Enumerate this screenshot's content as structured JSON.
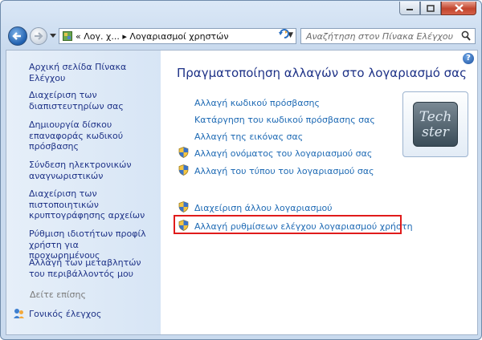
{
  "window": {
    "minimize_icon": "minimize-icon",
    "maximize_icon": "maximize-icon",
    "close_icon": "close-icon"
  },
  "navigation": {
    "breadcrumb_prefix": "«",
    "breadcrumb_parent": "Λογ. χ...",
    "breadcrumb_separator": "▸",
    "breadcrumb_current": "Λογαριασμοί χρηστών",
    "search_placeholder": "Αναζήτηση στον Πίνακα Ελέγχου"
  },
  "sidebar": {
    "items": [
      "Αρχική σελίδα Πίνακα Ελέγχου",
      "Διαχείριση των διαπιστευτηρίων σας",
      "Δημιουργία δίσκου επαναφοράς κωδικού πρόσβασης",
      "Σύνδεση ηλεκτρονικών αναγνωριστικών",
      "Διαχείριση των πιστοποιητικών κρυπτογράφησης αρχείων",
      "Ρύθμιση ιδιοτήτων προφίλ χρήστη για προχωρημένους",
      "Αλλαγή των μεταβλητών του περιβάλλοντός μου"
    ],
    "see_also_label": "Δείτε επίσης",
    "see_also_items": [
      "Γονικός έλεγχος"
    ]
  },
  "main": {
    "heading": "Πραγματοποίηση αλλαγών στο λογαριασμό σας",
    "links": [
      "Αλλαγή κωδικού πρόσβασης",
      "Κατάργηση του κωδικού πρόσβασης σας",
      "Αλλαγή της εικόνας σας",
      "Αλλαγή ονόματος του λογαριασμού σας",
      "Αλλαγή του τύπου του λογαριασμού σας"
    ],
    "other_links": [
      "Διαχείριση άλλου λογαριασμού",
      "Αλλαγή ρυθμίσεων ελέγχου λογαριασμού χρήστη"
    ],
    "highlight_color": "#e01b1b",
    "avatar_text_line1": "Tech",
    "avatar_text_line2": "ster",
    "help_label": "?"
  }
}
